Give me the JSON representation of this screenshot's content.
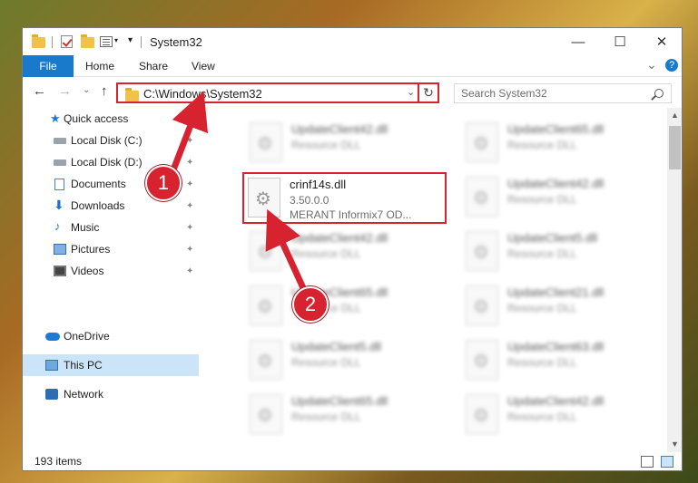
{
  "window": {
    "title": "System32",
    "controls": {
      "minimize": "—",
      "maximize": "☐",
      "close": "✕"
    }
  },
  "ribbon": {
    "tabs": [
      {
        "label": "File"
      },
      {
        "label": "Home"
      },
      {
        "label": "Share"
      },
      {
        "label": "View"
      }
    ],
    "expand_glyph": "⌄",
    "help_glyph": "?"
  },
  "navigation": {
    "back": "←",
    "forward": "→",
    "recent": "⌄",
    "up": "↑",
    "address": "C:\\Windows\\System32",
    "address_dropdown": "⌄",
    "refresh": "↻",
    "search_placeholder": "Search System32"
  },
  "nav_pane": {
    "items": [
      {
        "label": "Quick access",
        "icon": "star-icon",
        "pinned": false
      },
      {
        "label": "Local Disk (C:)",
        "icon": "drive-icon",
        "pinned": true
      },
      {
        "label": "Local Disk (D:)",
        "icon": "drive-icon",
        "pinned": true
      },
      {
        "label": "Documents",
        "icon": "documents-icon",
        "pinned": true
      },
      {
        "label": "Downloads",
        "icon": "downloads-icon",
        "pinned": true
      },
      {
        "label": "Music",
        "icon": "music-icon",
        "pinned": true
      },
      {
        "label": "Pictures",
        "icon": "pictures-icon",
        "pinned": true
      },
      {
        "label": "Videos",
        "icon": "videos-icon",
        "pinned": true
      },
      {
        "label": "OneDrive",
        "icon": "onedrive-icon",
        "pinned": false
      },
      {
        "label": "This PC",
        "icon": "this-pc-icon",
        "pinned": false,
        "selected": true
      },
      {
        "label": "Network",
        "icon": "network-icon",
        "pinned": false
      }
    ],
    "pin_glyph": "📌"
  },
  "files": {
    "highlighted": {
      "name": "crinf14s.dll",
      "version": "3.50.0.0",
      "description": "MERANT Informix7 OD..."
    },
    "left_column": [
      {
        "name": "UpdateClient42.dll",
        "type": "Resource DLL"
      },
      {
        "name": "UpdateClient42.dll",
        "type": "Resource DLL"
      },
      {
        "name": "UpdateClient65.dll",
        "type": "Resource DLL"
      },
      {
        "name": "UpdateClient5.dll",
        "type": "Resource DLL"
      },
      {
        "name": "UpdateClient65.dll",
        "type": "Resource DLL"
      }
    ],
    "right_column": [
      {
        "name": "UpdateClient65.dll",
        "type": "Resource DLL"
      },
      {
        "name": "UpdateClient42.dll",
        "type": "Resource DLL"
      },
      {
        "name": "UpdateClient5.dll",
        "type": "Resource DLL"
      },
      {
        "name": "UpdateClient21.dll",
        "type": "Resource DLL"
      },
      {
        "name": "UpdateClient63.dll",
        "type": "Resource DLL"
      },
      {
        "name": "UpdateClient42.dll",
        "type": "Resource DLL"
      }
    ]
  },
  "status": {
    "item_count": "193 items"
  },
  "annotations": {
    "step1": "1",
    "step2": "2",
    "color": "#d7222f"
  }
}
